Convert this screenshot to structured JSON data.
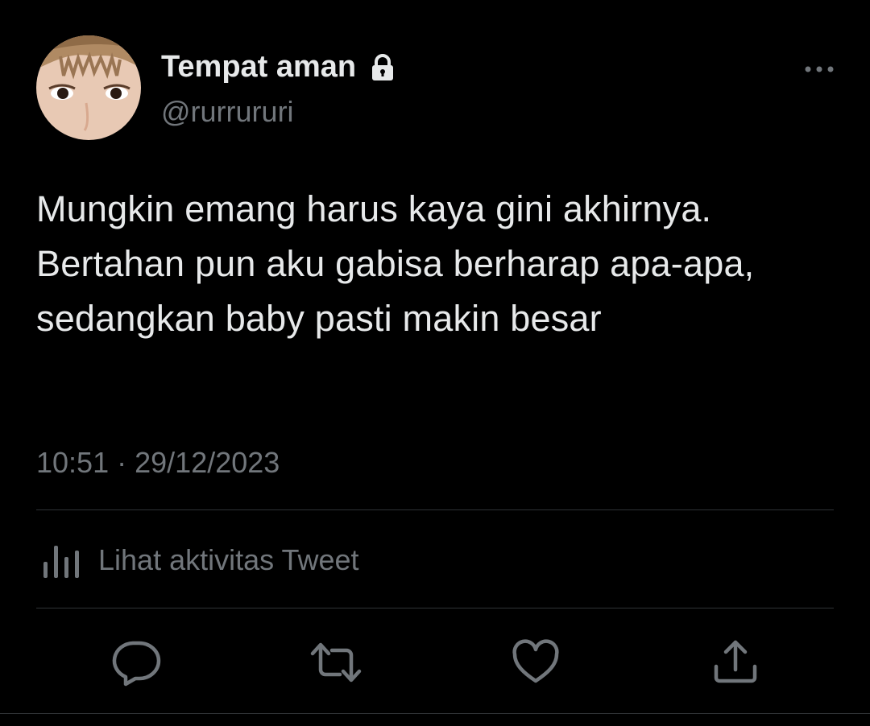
{
  "user": {
    "display_name": "Tempat aman",
    "handle": "@rurrururi",
    "protected_icon": "lock-icon",
    "avatar_icon": "avatar"
  },
  "tweet": {
    "text": "Mungkin emang harus kaya gini akhirnya. Bertahan pun aku gabisa berharap apa-apa, sedangkan baby pasti makin besar",
    "time": "10:51",
    "separator": "·",
    "date": "29/12/2023"
  },
  "activity": {
    "label": "Lihat aktivitas Tweet",
    "icon": "analytics-icon"
  },
  "actions": [
    {
      "icon": "reply-icon"
    },
    {
      "icon": "retweet-icon"
    },
    {
      "icon": "like-icon"
    },
    {
      "icon": "share-icon"
    }
  ],
  "menu": {
    "icon": "more-icon"
  },
  "colors": {
    "background": "#000000",
    "text": "#e7e9ea",
    "secondary": "#71767b",
    "divider": "#2f3336"
  }
}
